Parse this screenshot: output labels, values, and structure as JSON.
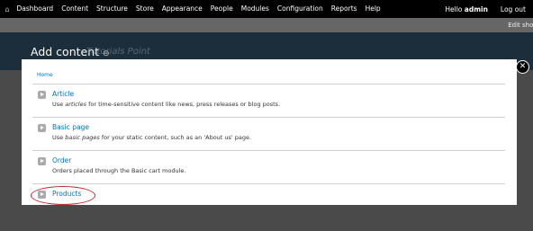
{
  "toolbar": {
    "home_icon": "home-icon",
    "items": [
      "Dashboard",
      "Content",
      "Structure",
      "Store",
      "Appearance",
      "People",
      "Modules",
      "Configuration",
      "Reports",
      "Help"
    ],
    "hello_prefix": "Hello",
    "username": "admin",
    "logout": "Log out"
  },
  "shortcuts": {
    "edit": "Edit short"
  },
  "header": {
    "title": "Add content",
    "pin_icon": "pin-icon"
  },
  "watermark": "Tutorials Point",
  "overlay": {
    "breadcrumb": "Home",
    "items": [
      {
        "label": "Article",
        "desc_pre": "Use ",
        "desc_em": "articles",
        "desc_post": " for time-sensitive content like news, press releases or blog posts."
      },
      {
        "label": "Basic page",
        "desc_pre": "Use ",
        "desc_em": "basic pages",
        "desc_post": " for your static content, such as an 'About us' page."
      },
      {
        "label": "Order",
        "desc_pre": "Orders placed through the Basic cart module.",
        "desc_em": "",
        "desc_post": ""
      },
      {
        "label": "Products",
        "desc_pre": "",
        "desc_em": "",
        "desc_post": ""
      }
    ],
    "close_symbol": "✕"
  },
  "colors": {
    "link": "#0074bd",
    "toolbar": "#000000",
    "header": "#1c2e3b",
    "highlight": "#c0272d"
  }
}
